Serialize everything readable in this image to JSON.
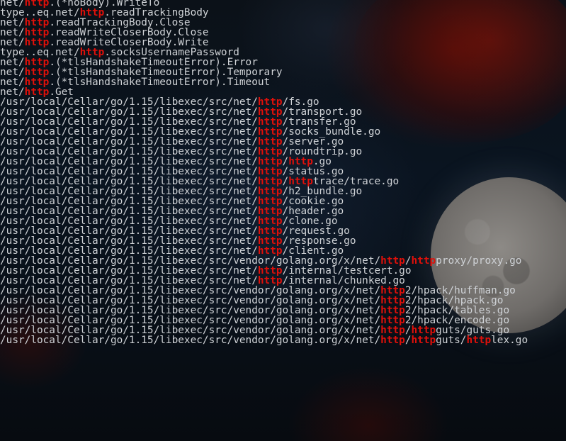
{
  "terminal": {
    "highlight": "http",
    "highlight_color": "#e0100a",
    "text_color": "#cfd2d6",
    "lines": [
      "net/http.(*noBody).WriteTo",
      "type..eq.net/http.readTrackingBody",
      "net/http.readTrackingBody.Close",
      "net/http.readWriteCloserBody.Close",
      "net/http.readWriteCloserBody.Write",
      "type..eq.net/http.socksUsernamePassword",
      "net/http.(*tlsHandshakeTimeoutError).Error",
      "net/http.(*tlsHandshakeTimeoutError).Temporary",
      "net/http.(*tlsHandshakeTimeoutError).Timeout",
      "net/http.Get",
      "/usr/local/Cellar/go/1.15/libexec/src/net/http/fs.go",
      "/usr/local/Cellar/go/1.15/libexec/src/net/http/transport.go",
      "/usr/local/Cellar/go/1.15/libexec/src/net/http/transfer.go",
      "/usr/local/Cellar/go/1.15/libexec/src/net/http/socks_bundle.go",
      "/usr/local/Cellar/go/1.15/libexec/src/net/http/server.go",
      "/usr/local/Cellar/go/1.15/libexec/src/net/http/roundtrip.go",
      "/usr/local/Cellar/go/1.15/libexec/src/net/http/http.go",
      "/usr/local/Cellar/go/1.15/libexec/src/net/http/status.go",
      "/usr/local/Cellar/go/1.15/libexec/src/net/http/httptrace/trace.go",
      "/usr/local/Cellar/go/1.15/libexec/src/net/http/h2_bundle.go",
      "/usr/local/Cellar/go/1.15/libexec/src/net/http/cookie.go",
      "/usr/local/Cellar/go/1.15/libexec/src/net/http/header.go",
      "/usr/local/Cellar/go/1.15/libexec/src/net/http/clone.go",
      "/usr/local/Cellar/go/1.15/libexec/src/net/http/request.go",
      "/usr/local/Cellar/go/1.15/libexec/src/net/http/response.go",
      "/usr/local/Cellar/go/1.15/libexec/src/net/http/client.go",
      "/usr/local/Cellar/go/1.15/libexec/src/vendor/golang.org/x/net/http/httpproxy/proxy.go",
      "/usr/local/Cellar/go/1.15/libexec/src/net/http/internal/testcert.go",
      "/usr/local/Cellar/go/1.15/libexec/src/net/http/internal/chunked.go",
      "/usr/local/Cellar/go/1.15/libexec/src/vendor/golang.org/x/net/http2/hpack/huffman.go",
      "/usr/local/Cellar/go/1.15/libexec/src/vendor/golang.org/x/net/http2/hpack/hpack.go",
      "/usr/local/Cellar/go/1.15/libexec/src/vendor/golang.org/x/net/http2/hpack/tables.go",
      "/usr/local/Cellar/go/1.15/libexec/src/vendor/golang.org/x/net/http2/hpack/encode.go",
      "/usr/local/Cellar/go/1.15/libexec/src/vendor/golang.org/x/net/http/httpguts/guts.go",
      "/usr/local/Cellar/go/1.15/libexec/src/vendor/golang.org/x/net/http/httpguts/httplex.go"
    ]
  }
}
